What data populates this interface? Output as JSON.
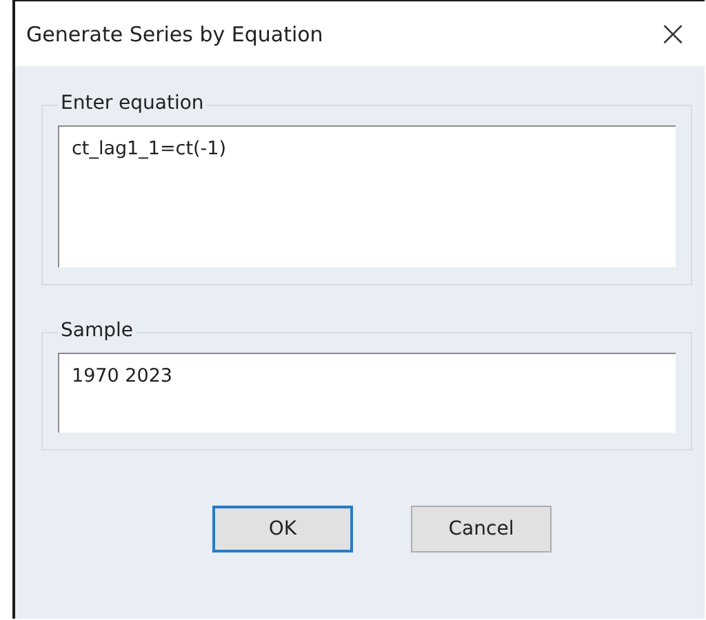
{
  "window": {
    "title": "Generate Series by Equation",
    "close": "×"
  },
  "groups": [
    {
      "label": "Enter equation",
      "value": "ct_lag1_1=ct(-1)",
      "kind": "multiline"
    },
    {
      "label": "Sample",
      "value": "1970 2023",
      "kind": "singleline"
    }
  ],
  "buttons": [
    {
      "label": "OK",
      "default": true
    },
    {
      "label": "Cancel",
      "default": false
    }
  ]
}
